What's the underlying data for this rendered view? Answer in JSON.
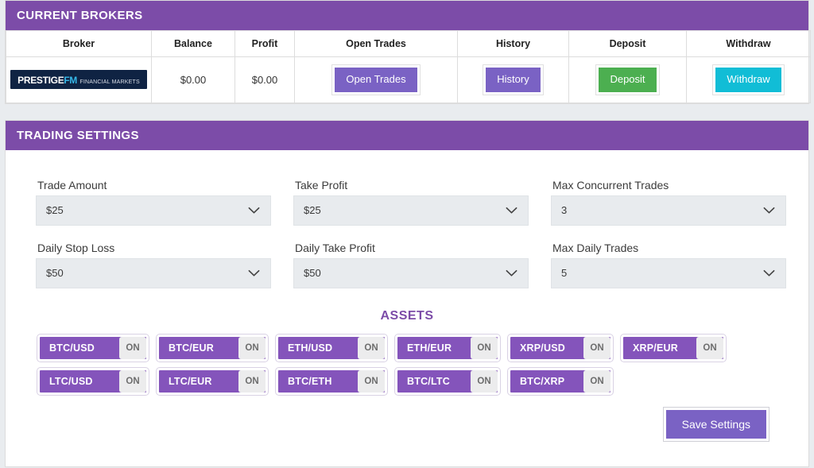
{
  "brokers": {
    "header": "CURRENT BROKERS",
    "columns": [
      "Broker",
      "Balance",
      "Profit",
      "Open Trades",
      "History",
      "Deposit",
      "Withdraw"
    ],
    "row": {
      "logo_name": "PRESTIGE",
      "logo_suffix": "FM",
      "logo_subtitle": "FINANCIAL MARKETS",
      "balance": "$0.00",
      "profit": "$0.00",
      "open_trades_label": "Open Trades",
      "history_label": "History",
      "deposit_label": "Deposit",
      "withdraw_label": "Withdraw"
    },
    "colors": {
      "header_purple": "#7c4ca8",
      "button_purple": "#7a62c4",
      "deposit_green": "#4caf50",
      "withdraw_cyan": "#11bdd6",
      "logo_navy": "#0f2343",
      "logo_accent": "#36b7e8"
    }
  },
  "settings": {
    "header": "TRADING SETTINGS",
    "fields": [
      {
        "label": "Trade Amount",
        "value": "$25"
      },
      {
        "label": "Take Profit",
        "value": "$25"
      },
      {
        "label": "Max Concurrent Trades",
        "value": "3"
      },
      {
        "label": "Daily Stop Loss",
        "value": "$50"
      },
      {
        "label": "Daily Take Profit",
        "value": "$50"
      },
      {
        "label": "Max Daily Trades",
        "value": "5"
      }
    ],
    "assets_title": "ASSETS",
    "assets": [
      {
        "name": "BTC/USD",
        "state": "ON"
      },
      {
        "name": "BTC/EUR",
        "state": "ON"
      },
      {
        "name": "ETH/USD",
        "state": "ON"
      },
      {
        "name": "ETH/EUR",
        "state": "ON"
      },
      {
        "name": "XRP/USD",
        "state": "ON"
      },
      {
        "name": "XRP/EUR",
        "state": "ON"
      },
      {
        "name": "LTC/USD",
        "state": "ON"
      },
      {
        "name": "LTC/EUR",
        "state": "ON"
      },
      {
        "name": "BTC/ETH",
        "state": "ON"
      },
      {
        "name": "BTC/LTC",
        "state": "ON"
      },
      {
        "name": "BTC/XRP",
        "state": "ON"
      }
    ],
    "save_label": "Save Settings",
    "colors": {
      "asset_purple": "#8454bb",
      "assets_title_purple": "#7c4ca8"
    }
  }
}
